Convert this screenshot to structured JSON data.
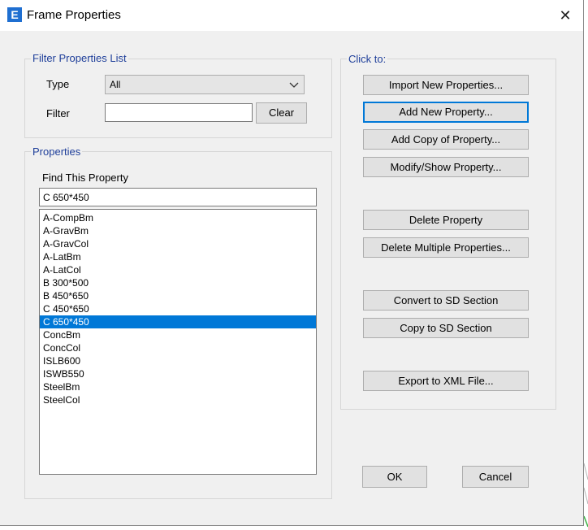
{
  "window": {
    "app_icon": "E",
    "title": "Frame Properties",
    "close_glyph": "✕"
  },
  "filter": {
    "legend": "Filter Properties List",
    "type_label": "Type",
    "type_value": "All",
    "filter_label": "Filter",
    "filter_value": "",
    "clear_label": "Clear"
  },
  "properties": {
    "legend": "Properties",
    "find_label": "Find This Property",
    "find_value": "C 650*450",
    "items": [
      "A-CompBm",
      "A-GravBm",
      "A-GravCol",
      "A-LatBm",
      "A-LatCol",
      "B 300*500",
      "B 450*650",
      "C 450*650",
      "C 650*450",
      "ConcBm",
      "ConcCol",
      "ISLB600",
      "ISWB550",
      "SteelBm",
      "SteelCol"
    ],
    "selected": "C 650*450"
  },
  "actions": {
    "legend": "Click to:",
    "import": "Import New Properties...",
    "add_new": "Add New Property...",
    "add_copy": "Add Copy of Property...",
    "modify": "Modify/Show Property...",
    "delete": "Delete Property",
    "delete_multiple": "Delete Multiple Properties...",
    "convert_sd": "Convert to SD Section",
    "copy_sd": "Copy to SD Section",
    "export_xml": "Export to XML File..."
  },
  "footer": {
    "ok": "OK",
    "cancel": "Cancel"
  },
  "icons": {
    "app": "etabs-app-icon",
    "close": "close-icon",
    "dropdown": "chevron-down-icon"
  },
  "colors": {
    "accent": "#0078d7",
    "legend": "#1f3f9a",
    "app_icon": "#1f6fd1"
  }
}
